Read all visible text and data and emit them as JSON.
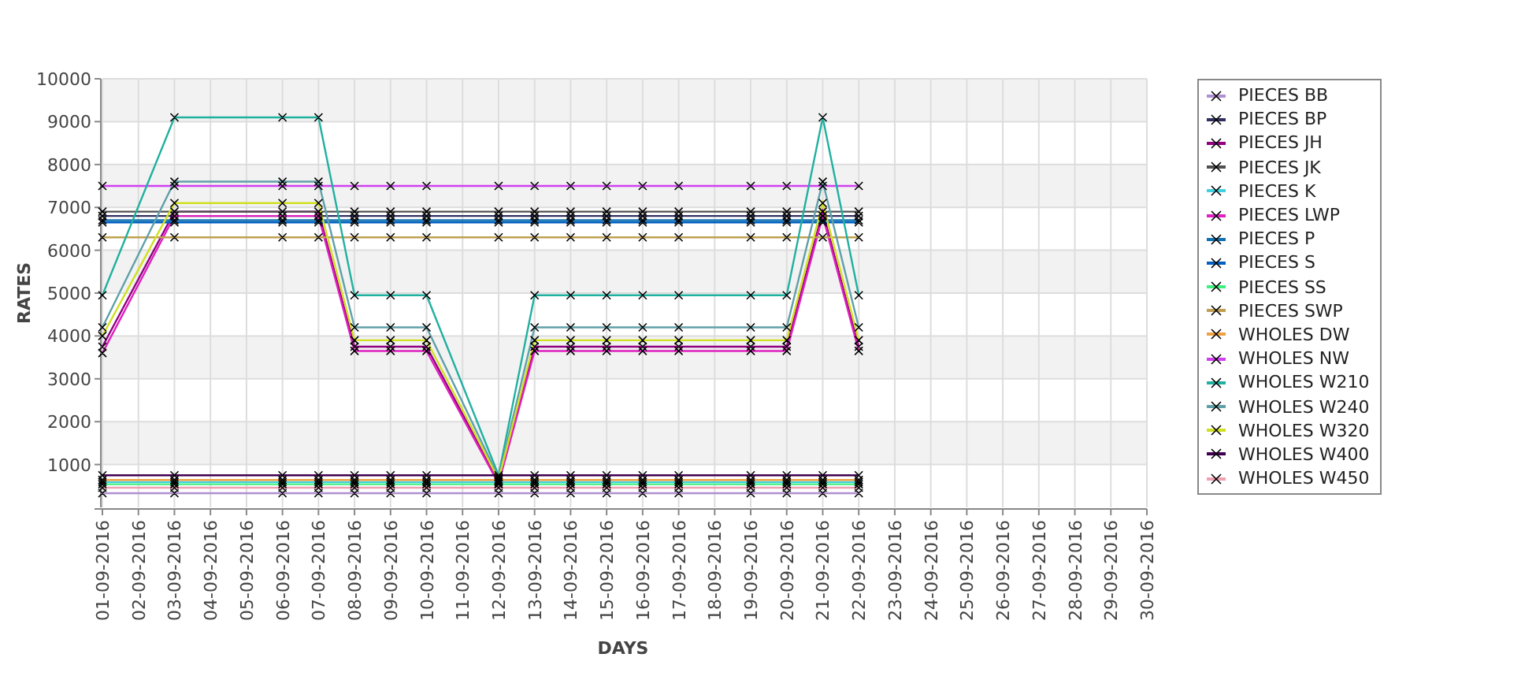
{
  "chart_data": {
    "type": "line",
    "grid": true,
    "xlabel": "DAYS",
    "ylabel": "RATES",
    "categories": [
      "01-09-2016",
      "02-09-2016",
      "03-09-2016",
      "04-09-2016",
      "05-09-2016",
      "06-09-2016",
      "07-09-2016",
      "08-09-2016",
      "09-09-2016",
      "10-09-2016",
      "11-09-2016",
      "12-09-2016",
      "13-09-2016",
      "14-09-2016",
      "15-09-2016",
      "16-09-2016",
      "17-09-2016",
      "18-09-2016",
      "19-09-2016",
      "20-09-2016",
      "21-09-2016",
      "22-09-2016",
      "23-09-2016",
      "24-09-2016",
      "25-09-2016",
      "26-09-2016",
      "27-09-2016",
      "28-09-2016",
      "29-09-2016",
      "30-09-2016"
    ],
    "ylim": [
      0,
      10000
    ],
    "yticks": [
      1000,
      2000,
      3000,
      4000,
      5000,
      6000,
      7000,
      8000,
      9000,
      10000
    ],
    "series": [
      {
        "name": "PIECES BB",
        "marker": "x",
        "color": "#b090d0",
        "values": [
          330,
          null,
          330,
          null,
          null,
          330,
          330,
          330,
          330,
          330,
          null,
          330,
          330,
          330,
          330,
          330,
          330,
          null,
          330,
          330,
          330,
          330,
          null,
          null,
          null,
          null,
          null,
          null,
          null,
          null
        ]
      },
      {
        "name": "PIECES BP",
        "marker": "x",
        "color": "#303060",
        "values": [
          6800,
          null,
          6800,
          null,
          null,
          6800,
          6800,
          6800,
          6800,
          6800,
          null,
          6800,
          6800,
          6800,
          6800,
          6800,
          6800,
          null,
          6800,
          6800,
          6800,
          6800,
          null,
          null,
          null,
          null,
          null,
          null,
          null,
          null
        ]
      },
      {
        "name": "PIECES JH",
        "marker": "x",
        "color": "#900080",
        "values": [
          3750,
          null,
          6900,
          null,
          null,
          6900,
          6900,
          3750,
          3750,
          3750,
          null,
          600,
          3750,
          3750,
          3750,
          3750,
          3750,
          null,
          3750,
          3750,
          6900,
          3750,
          null,
          null,
          null,
          null,
          null,
          null,
          null,
          null
        ]
      },
      {
        "name": "PIECES JK",
        "marker": "x",
        "color": "#505050",
        "values": [
          6900,
          null,
          6900,
          null,
          null,
          6900,
          6900,
          6900,
          6900,
          6900,
          null,
          6900,
          6900,
          6900,
          6900,
          6900,
          6900,
          null,
          6900,
          6900,
          6900,
          6900,
          null,
          null,
          null,
          null,
          null,
          null,
          null,
          null
        ]
      },
      {
        "name": "PIECES K",
        "marker": "x",
        "color": "#40d0e0",
        "values": [
          590,
          null,
          590,
          null,
          null,
          590,
          590,
          590,
          590,
          590,
          null,
          590,
          590,
          590,
          590,
          590,
          590,
          null,
          590,
          590,
          590,
          590,
          null,
          null,
          null,
          null,
          null,
          null,
          null,
          null
        ]
      },
      {
        "name": "PIECES LWP",
        "marker": "x",
        "color": "#e020c0",
        "values": [
          3600,
          null,
          6800,
          null,
          null,
          6800,
          6800,
          3650,
          3650,
          3650,
          null,
          550,
          3650,
          3650,
          3650,
          3650,
          3650,
          null,
          3650,
          3650,
          6800,
          3650,
          null,
          null,
          null,
          null,
          null,
          null,
          null,
          null
        ]
      },
      {
        "name": "PIECES P",
        "marker": "x",
        "color": "#1070b0",
        "values": [
          6700,
          null,
          6700,
          null,
          null,
          6700,
          6700,
          6700,
          6700,
          6700,
          null,
          6700,
          6700,
          6700,
          6700,
          6700,
          6700,
          null,
          6700,
          6700,
          6700,
          6700,
          null,
          null,
          null,
          null,
          null,
          null,
          null,
          null
        ]
      },
      {
        "name": "PIECES S",
        "marker": "x",
        "color": "#0060c0",
        "values": [
          6650,
          null,
          6650,
          null,
          null,
          6650,
          6650,
          6650,
          6650,
          6650,
          null,
          6650,
          6650,
          6650,
          6650,
          6650,
          6650,
          null,
          6650,
          6650,
          6650,
          6650,
          null,
          null,
          null,
          null,
          null,
          null,
          null,
          null
        ]
      },
      {
        "name": "PIECES SS",
        "marker": "x",
        "color": "#40f080",
        "values": [
          540,
          null,
          540,
          null,
          null,
          540,
          540,
          540,
          540,
          540,
          null,
          540,
          540,
          540,
          540,
          540,
          540,
          null,
          540,
          540,
          540,
          540,
          null,
          null,
          null,
          null,
          null,
          null,
          null,
          null
        ]
      },
      {
        "name": "PIECES SWP",
        "marker": "x",
        "color": "#c0a050",
        "values": [
          6300,
          null,
          6300,
          null,
          null,
          6300,
          6300,
          6300,
          6300,
          6300,
          null,
          6300,
          6300,
          6300,
          6300,
          6300,
          6300,
          null,
          6300,
          6300,
          6300,
          6300,
          null,
          null,
          null,
          null,
          null,
          null,
          null,
          null
        ]
      },
      {
        "name": "WHOLES DW",
        "marker": "x",
        "color": "#f0a040",
        "values": [
          640,
          null,
          640,
          null,
          null,
          640,
          640,
          640,
          640,
          640,
          null,
          640,
          640,
          640,
          640,
          640,
          640,
          null,
          640,
          640,
          640,
          640,
          null,
          null,
          null,
          null,
          null,
          null,
          null,
          null
        ]
      },
      {
        "name": "WHOLES NW",
        "marker": "x",
        "color": "#d040f0",
        "values": [
          7500,
          null,
          7500,
          null,
          null,
          7500,
          7500,
          7500,
          7500,
          7500,
          null,
          7500,
          7500,
          7500,
          7500,
          7500,
          7500,
          null,
          7500,
          7500,
          7500,
          7500,
          null,
          null,
          null,
          null,
          null,
          null,
          null,
          null
        ]
      },
      {
        "name": "WHOLES W210",
        "marker": "x",
        "color": "#20b0a0",
        "values": [
          4950,
          null,
          9100,
          null,
          null,
          9100,
          9100,
          4950,
          4950,
          4950,
          null,
          750,
          4950,
          4950,
          4950,
          4950,
          4950,
          null,
          4950,
          4950,
          9100,
          4950,
          null,
          null,
          null,
          null,
          null,
          null,
          null,
          null
        ]
      },
      {
        "name": "WHOLES W240",
        "marker": "x",
        "color": "#60a0a8",
        "values": [
          4200,
          null,
          7600,
          null,
          null,
          7600,
          7600,
          4200,
          4200,
          4200,
          null,
          700,
          4200,
          4200,
          4200,
          4200,
          4200,
          null,
          4200,
          4200,
          7600,
          4200,
          null,
          null,
          null,
          null,
          null,
          null,
          null,
          null
        ]
      },
      {
        "name": "WHOLES W320",
        "marker": "x",
        "color": "#d0e020",
        "values": [
          4000,
          null,
          7100,
          null,
          null,
          7100,
          7100,
          3900,
          3900,
          3900,
          null,
          650,
          3900,
          3900,
          3900,
          3900,
          3900,
          null,
          3900,
          3900,
          7100,
          3900,
          null,
          null,
          null,
          null,
          null,
          null,
          null,
          null
        ]
      },
      {
        "name": "WHOLES W400",
        "marker": "x",
        "color": "#400050",
        "values": [
          750,
          null,
          750,
          null,
          null,
          750,
          750,
          750,
          750,
          750,
          null,
          750,
          750,
          750,
          750,
          750,
          750,
          null,
          750,
          750,
          750,
          750,
          null,
          null,
          null,
          null,
          null,
          null,
          null,
          null
        ]
      },
      {
        "name": "WHOLES W450",
        "marker": "x",
        "color": "#f0a0b0",
        "values": [
          460,
          null,
          460,
          null,
          null,
          460,
          460,
          460,
          460,
          460,
          null,
          460,
          460,
          460,
          460,
          460,
          460,
          null,
          460,
          460,
          460,
          460,
          null,
          null,
          null,
          null,
          null,
          null,
          null,
          null
        ]
      }
    ]
  }
}
